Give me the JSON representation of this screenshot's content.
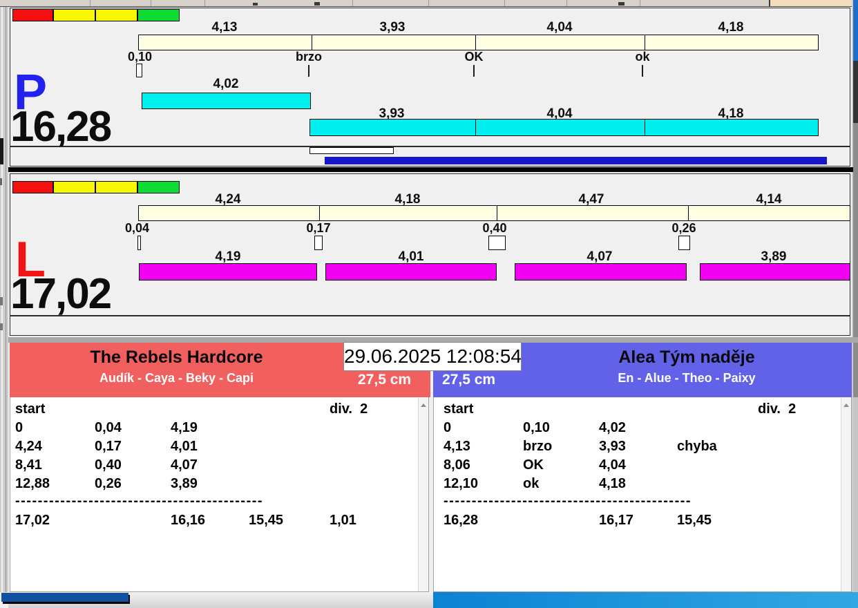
{
  "window": {
    "datetime": "29.06.2025 12:08:54"
  },
  "icons": {
    "scrollbar_up": "chevron-up",
    "traffic_lights": [
      "red",
      "yellow",
      "yellow",
      "green"
    ]
  },
  "colors": {
    "lane_p_letter": "#2121f0",
    "lane_l_letter": "#f01414",
    "split_bar": "#ffffe1",
    "run_bar_p": "#00efef",
    "run_bar_l": "#f000f0",
    "progress_bar": "#1717c9",
    "team_left_header": "#f25f5f",
    "team_right_header": "#6262e9",
    "light_red": "#f50f0f",
    "light_yellow": "#f7f700",
    "light_green": "#0fdc32"
  },
  "lane_p": {
    "letter": "P",
    "total_time": "16,28",
    "split_times": [
      "4,13",
      "3,93",
      "4,04",
      "4,18"
    ],
    "change_marks": [
      "0,10",
      "brzo",
      "OK",
      "ok"
    ],
    "first_run_time": "4,02",
    "run_times": [
      "3,93",
      "4,04",
      "4,18"
    ]
  },
  "lane_l": {
    "letter": "L",
    "total_time": "17,02",
    "split_times": [
      "4,24",
      "4,18",
      "4,47",
      "4,14"
    ],
    "change_marks": [
      "0,04",
      "0,17",
      "0,40",
      "0,26"
    ],
    "run_times": [
      "4,19",
      "4,01",
      "4,07",
      "3,89"
    ]
  },
  "team_left": {
    "name": "The Rebels Hardcore",
    "members": "Audík - Caya - Beky - Capi",
    "jump_height": "27,5 cm",
    "start_label": "start",
    "division": "div.  2",
    "rows": [
      [
        "0",
        "0,04",
        "4,19",
        ""
      ],
      [
        "4,24",
        "0,17",
        "4,01",
        ""
      ],
      [
        "8,41",
        "0,40",
        "4,07",
        ""
      ],
      [
        "12,88",
        "0,26",
        "3,89",
        ""
      ]
    ],
    "separator": "--------------------------------------------",
    "totals": [
      "17,02",
      "16,16",
      "15,45",
      "1,01"
    ]
  },
  "team_right": {
    "name": "Alea Tým naděje",
    "members": "En - Alue - Theo - Paixy",
    "jump_height": "27,5 cm",
    "start_label": "start",
    "division": "div.  2",
    "rows": [
      [
        "0",
        "0,10",
        "4,02",
        ""
      ],
      [
        "4,13",
        "brzo",
        "3,93",
        "chyba"
      ],
      [
        "8,06",
        "OK",
        "4,04",
        ""
      ],
      [
        "12,10",
        "ok",
        "4,18",
        ""
      ]
    ],
    "separator": "--------------------------------------------",
    "totals": [
      "16,28",
      "16,17",
      "15,45",
      ""
    ]
  }
}
